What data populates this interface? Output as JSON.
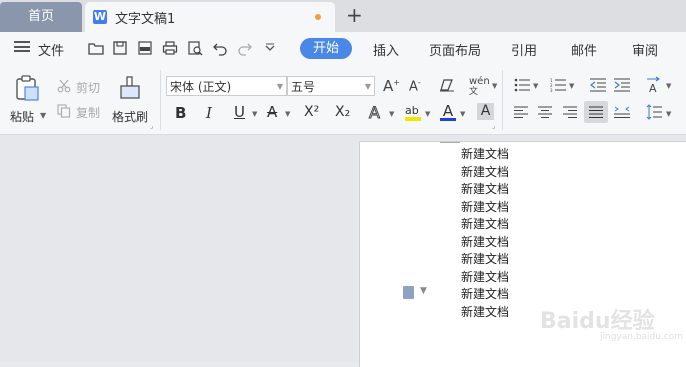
{
  "tabs": {
    "home": "首页",
    "document": "文字文稿1",
    "new_tab": "+"
  },
  "menu": {
    "file": "文件",
    "ribbon_tabs": [
      "开始",
      "插入",
      "页面布局",
      "引用",
      "邮件",
      "审阅"
    ]
  },
  "ribbon": {
    "paste": "粘贴",
    "cut": "剪切",
    "copy": "复制",
    "format_painter": "格式刷",
    "font_name": "宋体 (正文)",
    "font_size": "五号",
    "bold": "B",
    "italic": "I",
    "underline": "U",
    "strikethrough": "A",
    "superscript": "X²",
    "subscript": "X₂",
    "font_color_letter": "A",
    "text_effect_letter": "A",
    "highlight_text": "ab",
    "char_shading": "A",
    "grow_font": "A",
    "shrink_font": "A",
    "phonetic_guide": "wén"
  },
  "colors": {
    "accent": "#4a88e8",
    "home_tab": "#8a96ab",
    "font_color_bar": "#2040d0",
    "highlight_bar": "#f2e600"
  },
  "document": {
    "lines": [
      "新建文档",
      "新建文档",
      "新建文档",
      "新建文档",
      "新建文档",
      "新建文档",
      "新建文档",
      "新建文档",
      "新建文档",
      "新建文档"
    ]
  },
  "watermark": {
    "text": "Baidu经验",
    "sub": "jingyan.baidu.com"
  }
}
